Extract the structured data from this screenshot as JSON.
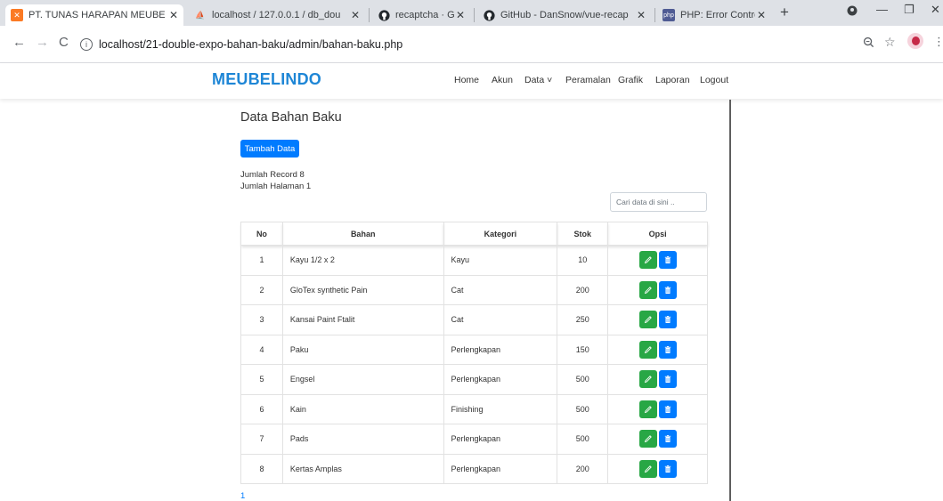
{
  "browser": {
    "tabs": [
      {
        "title": "PT. TUNAS HARAPAN MEUBE",
        "icon": "xampp-icon",
        "active": true
      },
      {
        "title": "localhost / 127.0.0.1 / db_dou",
        "icon": "phpmyadmin-icon",
        "active": false
      },
      {
        "title": "recaptcha · GitHub Topics · Gi",
        "icon": "github-icon",
        "active": false
      },
      {
        "title": "GitHub - DanSnow/vue-recap",
        "icon": "github-icon",
        "active": false
      },
      {
        "title": "PHP: Error Control Operators",
        "icon": "php-icon",
        "active": false
      }
    ],
    "url": "localhost/21-double-expo-bahan-baku/admin/bahan-baku.php"
  },
  "app": {
    "brand": "MEUBELINDO",
    "nav": [
      {
        "label": "Home"
      },
      {
        "label": "Akun"
      },
      {
        "label": "Data ˅"
      },
      {
        "label": "Peramalan"
      },
      {
        "label": "Grafik"
      },
      {
        "label": "Laporan"
      },
      {
        "label": "Logout"
      }
    ]
  },
  "page": {
    "title": "Data Bahan Baku",
    "add_button": "Tambah Data",
    "record_count": "Jumlah Record   8",
    "page_count": "Jumlah Halaman 1",
    "search_placeholder": "Cari data di sini ..",
    "pagination": "1"
  },
  "table": {
    "headers": [
      "No",
      "Bahan",
      "Kategori",
      "Stok",
      "Opsi"
    ],
    "rows": [
      {
        "no": "1",
        "bahan": "Kayu 1/2 x 2",
        "kategori": "Kayu",
        "stok": "10"
      },
      {
        "no": "2",
        "bahan": "GloTex synthetic Pain",
        "kategori": "Cat",
        "stok": "200"
      },
      {
        "no": "3",
        "bahan": "Kansai Paint Ftalit",
        "kategori": "Cat",
        "stok": "250"
      },
      {
        "no": "4",
        "bahan": "Paku",
        "kategori": "Perlengkapan",
        "stok": "150"
      },
      {
        "no": "5",
        "bahan": "Engsel",
        "kategori": "Perlengkapan",
        "stok": "500"
      },
      {
        "no": "6",
        "bahan": "Kain",
        "kategori": "Finishing",
        "stok": "500"
      },
      {
        "no": "7",
        "bahan": "Pads",
        "kategori": "Perlengkapan",
        "stok": "500"
      },
      {
        "no": "8",
        "bahan": "Kertas Amplas",
        "kategori": "Perlengkapan",
        "stok": "200"
      }
    ]
  },
  "colors": {
    "brand": "#1e86d6",
    "primary": "#007bff",
    "success": "#28a745"
  }
}
